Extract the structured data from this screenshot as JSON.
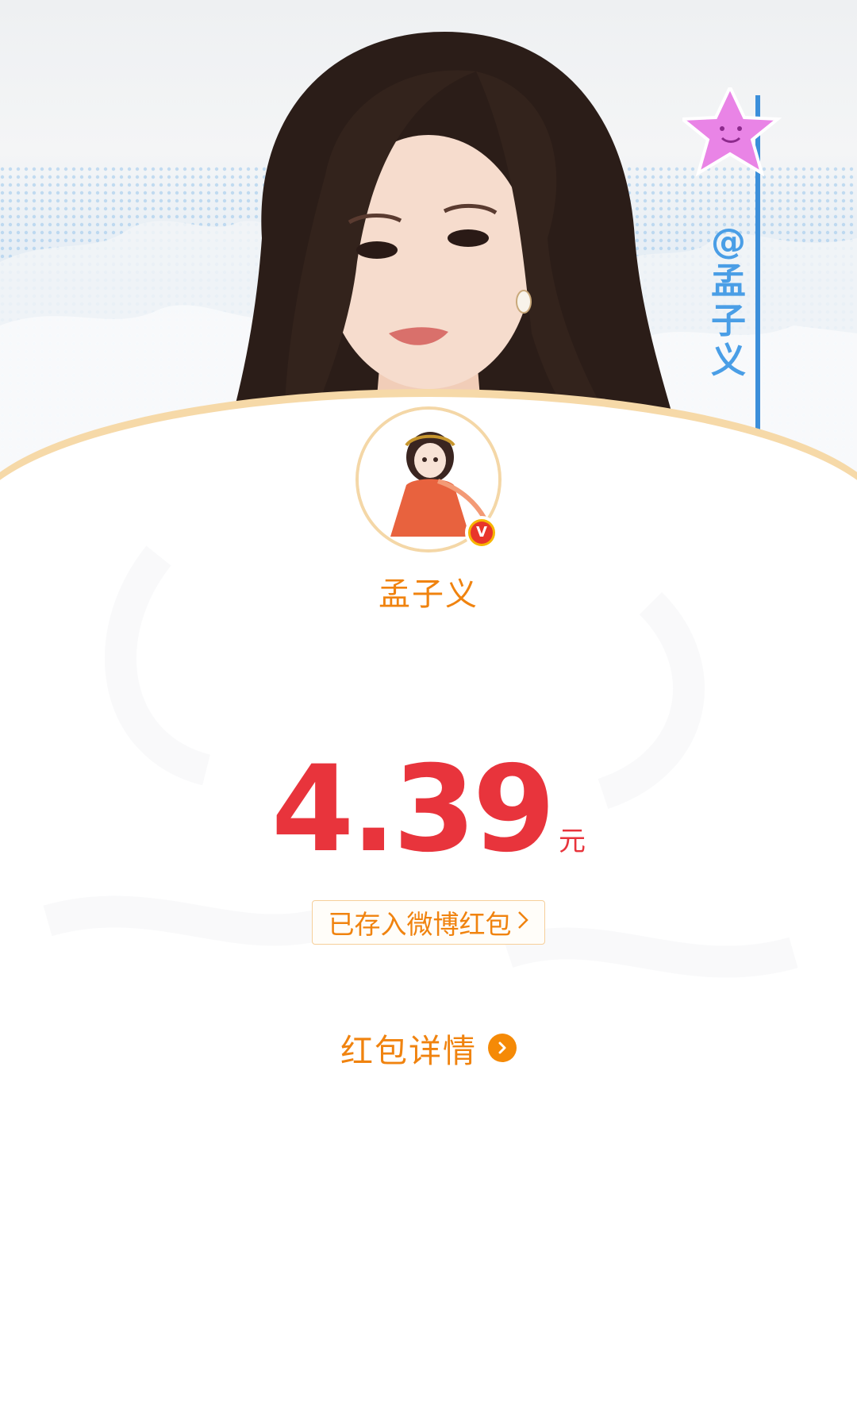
{
  "banner": {
    "side_tag": "@孟子义",
    "side_tag_chars": [
      "@",
      "孟",
      "子",
      "义"
    ]
  },
  "user": {
    "name": "孟子义",
    "verified_badge": "V"
  },
  "redpacket": {
    "amount": "4.39",
    "unit": "元",
    "saved_label": "已存入微博红包",
    "detail_label": "红包详情"
  },
  "icons": {
    "saved_chevron": "chevron-right-icon",
    "detail_arrow": "arrow-circle-right-icon",
    "star_sticker": "star-icon"
  },
  "colors": {
    "accent_orange": "#f0830f",
    "amount_red": "#e8343c",
    "tag_blue": "#4a9ee6",
    "verified_gold": "#f7b500"
  }
}
